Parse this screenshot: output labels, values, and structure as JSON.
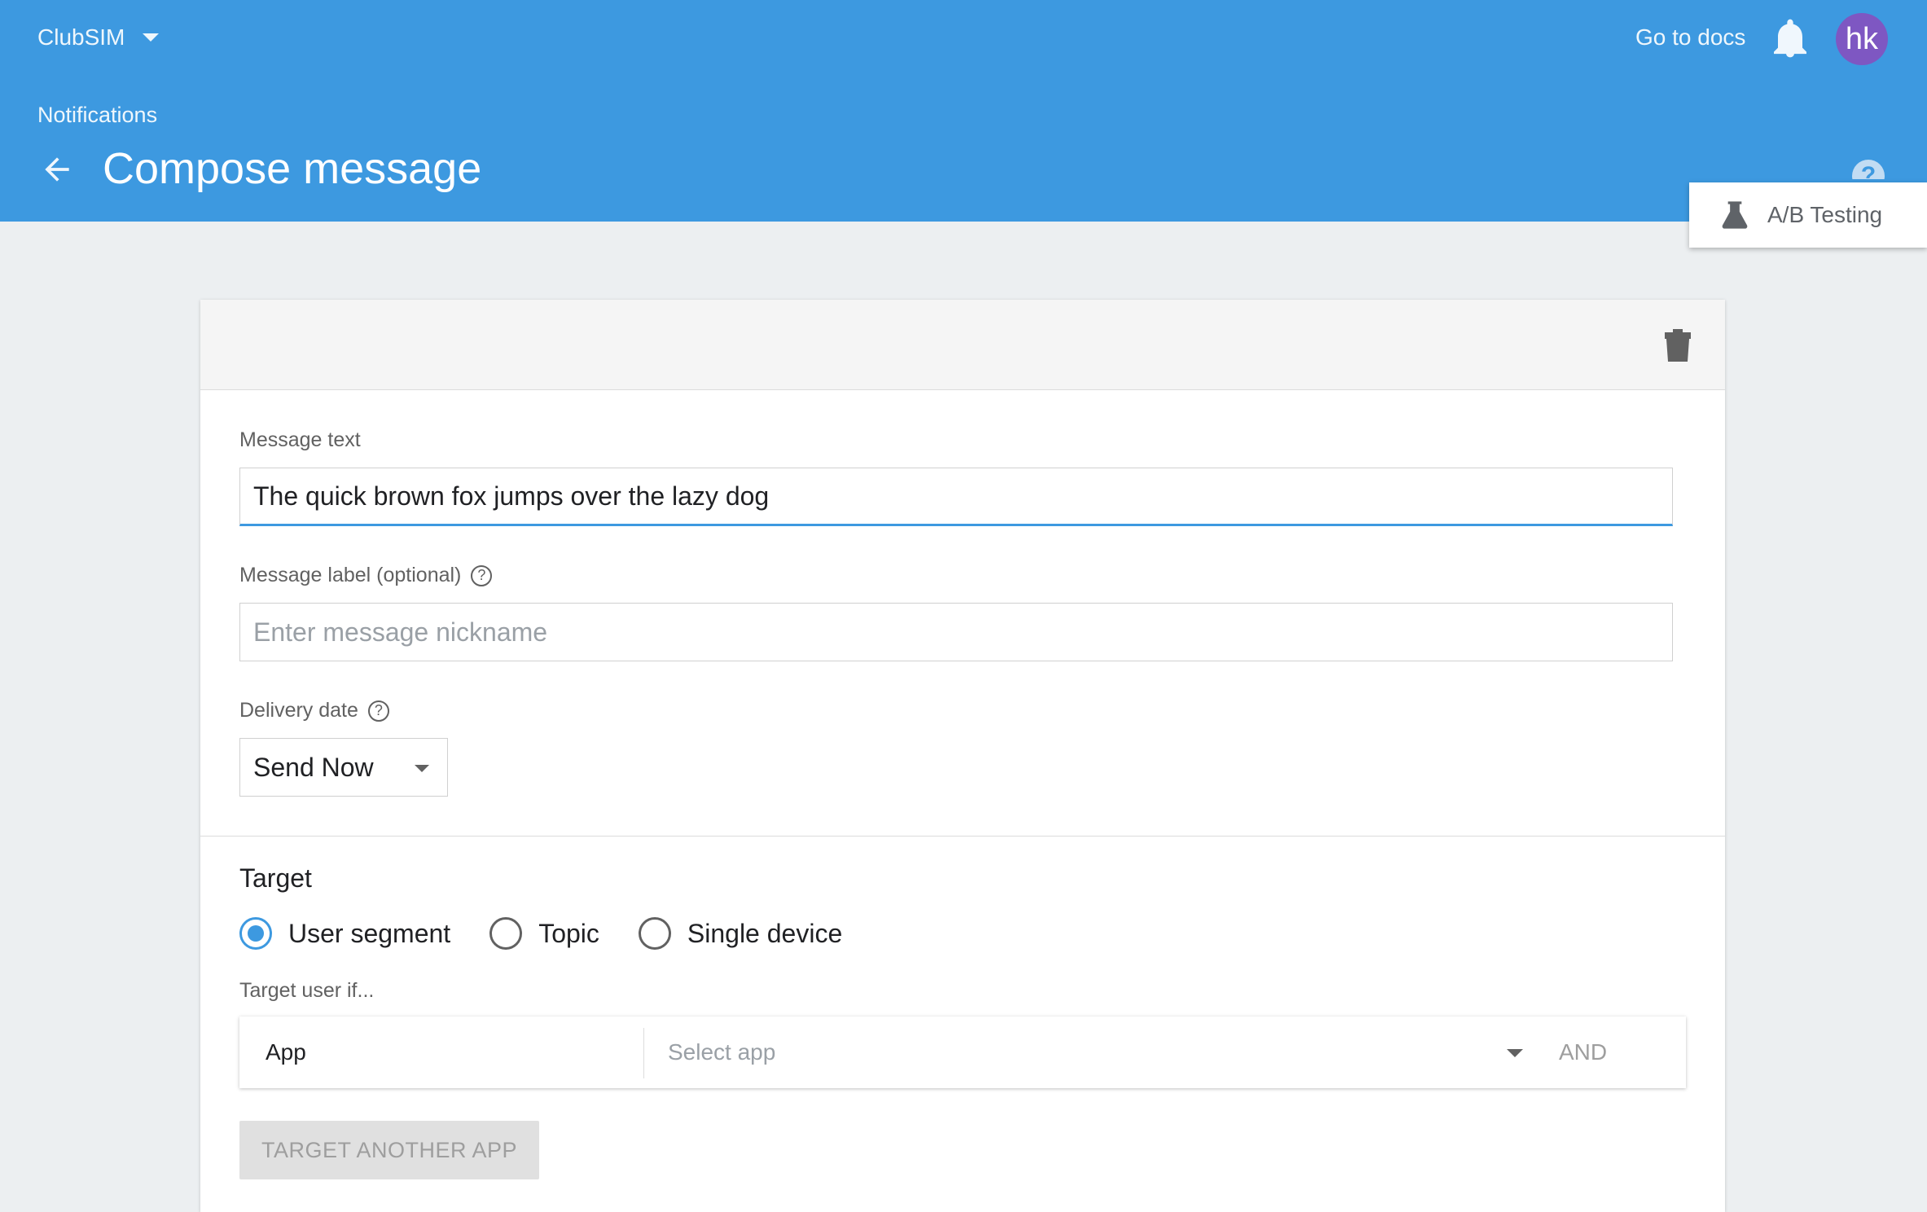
{
  "header": {
    "project_name": "ClubSIM",
    "docs_link": "Go to docs",
    "avatar_initials": "hk",
    "breadcrumb": "Notifications",
    "page_title": "Compose message",
    "ab_testing_label": "A/B Testing"
  },
  "form": {
    "message_text_label": "Message text",
    "message_text_value": "The quick brown fox jumps over the lazy dog",
    "message_label_label": "Message label (optional)",
    "message_label_placeholder": "Enter message nickname",
    "delivery_date_label": "Delivery date",
    "delivery_date_value": "Send Now",
    "help_glyph": "?"
  },
  "target": {
    "title": "Target",
    "options": [
      {
        "label": "User segment",
        "selected": true
      },
      {
        "label": "Topic",
        "selected": false
      },
      {
        "label": "Single device",
        "selected": false
      }
    ],
    "condition_label": "Target user if...",
    "row_label": "App",
    "select_placeholder": "Select app",
    "and_label": "AND",
    "another_button": "TARGET ANOTHER APP"
  },
  "icons": {
    "project_dropdown": "chevron-down-icon",
    "notifications": "bell-icon",
    "back": "arrow-left-icon",
    "help": "help-circle-icon",
    "ab_testing": "flask-icon",
    "delete": "trash-icon"
  },
  "colors": {
    "header_bg": "#3d99e0",
    "avatar_bg": "#7e57c2",
    "accent": "#3d99e0",
    "page_bg": "#eceff1"
  }
}
